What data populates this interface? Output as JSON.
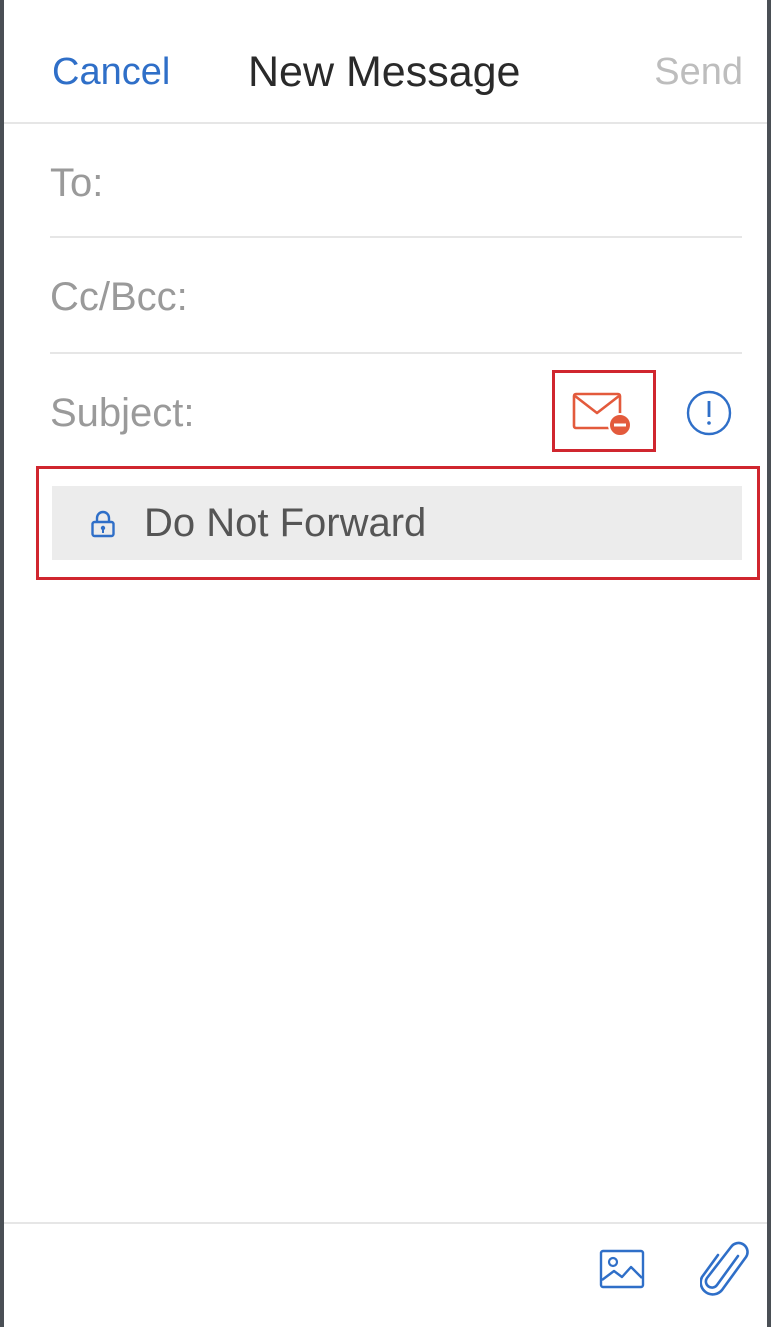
{
  "navbar": {
    "cancel_label": "Cancel",
    "title": "New Message",
    "send_label": "Send"
  },
  "fields": {
    "to_label": "To:",
    "cc_bcc_label": "Cc/Bcc:",
    "subject_label": "Subject:"
  },
  "subject_actions": {
    "encryption_icon": "envelope-no-forward-icon",
    "importance_icon": "exclamation-circle-icon"
  },
  "protection_banner": {
    "icon": "lock-icon",
    "label": "Do Not Forward"
  },
  "toolbar": {
    "image_icon": "image-icon",
    "attach_icon": "paperclip-icon"
  },
  "colors": {
    "accent": "#2f6fc8",
    "disabled": "#bdbdbd",
    "label": "#9a9a9a",
    "highlight": "#d0262f",
    "encryption_icon": "#e35a3c",
    "banner_bg": "#ececec"
  }
}
